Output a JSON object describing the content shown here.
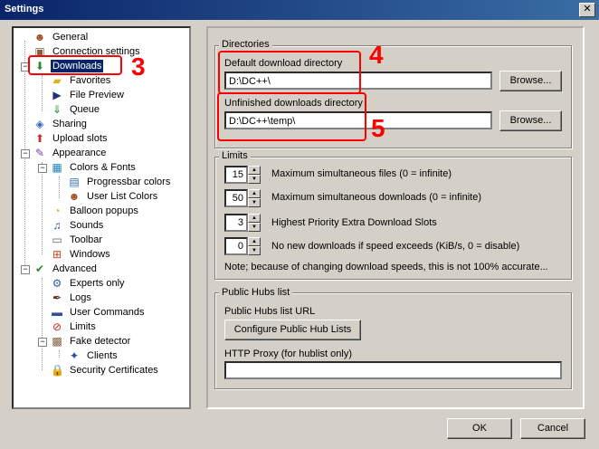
{
  "window": {
    "title": "Settings",
    "close_label": "✕"
  },
  "tree": {
    "items": [
      {
        "label": "General",
        "icon": "user-icon"
      },
      {
        "label": "Connection settings",
        "icon": "network-icon"
      },
      {
        "label": "Downloads",
        "icon": "download-icon"
      },
      {
        "label": "Favorites",
        "icon": "folder-icon"
      },
      {
        "label": "File Preview",
        "icon": "play-icon"
      },
      {
        "label": "Queue",
        "icon": "queue-icon"
      },
      {
        "label": "Sharing",
        "icon": "share-icon"
      },
      {
        "label": "Upload slots",
        "icon": "upload-icon"
      },
      {
        "label": "Appearance",
        "icon": "palette-icon"
      },
      {
        "label": "Colors & Fonts",
        "icon": "colors-icon"
      },
      {
        "label": "Progressbar colors",
        "icon": "progressbar-icon"
      },
      {
        "label": "User List Colors",
        "icon": "userlist-icon"
      },
      {
        "label": "Balloon popups",
        "icon": "balloon-icon"
      },
      {
        "label": "Sounds",
        "icon": "note-icon"
      },
      {
        "label": "Toolbar",
        "icon": "toolbar-icon"
      },
      {
        "label": "Windows",
        "icon": "windows-icon"
      },
      {
        "label": "Advanced",
        "icon": "check-icon"
      },
      {
        "label": "Experts only",
        "icon": "gear-icon"
      },
      {
        "label": "Logs",
        "icon": "log-icon"
      },
      {
        "label": "User Commands",
        "icon": "command-icon"
      },
      {
        "label": "Limits",
        "icon": "limit-icon"
      },
      {
        "label": "Fake detector",
        "icon": "detector-icon"
      },
      {
        "label": "Clients",
        "icon": "client-icon"
      },
      {
        "label": "Security Certificates",
        "icon": "lock-icon"
      }
    ]
  },
  "directories": {
    "legend": "Directories",
    "default_label": "Default download directory",
    "default_value": "D:\\DC++\\",
    "unfinished_label": "Unfinished downloads directory",
    "unfinished_value": "D:\\DC++\\temp\\",
    "browse_label": "Browse..."
  },
  "limits": {
    "legend": "Limits",
    "rows": [
      {
        "value": "15",
        "label": "Maximum simultaneous files (0 = infinite)"
      },
      {
        "value": "50",
        "label": "Maximum simultaneous downloads (0 = infinite)"
      },
      {
        "value": "3",
        "label": "Highest Priority Extra Download Slots"
      },
      {
        "value": "0",
        "label": "No new downloads if speed exceeds (KiB/s, 0 = disable)"
      }
    ],
    "note": "Note; because of changing download speeds, this is not 100% accurate..."
  },
  "hubs": {
    "legend": "Public Hubs list",
    "url_label": "Public Hubs list URL",
    "configure_label": "Configure Public Hub Lists",
    "proxy_label": "HTTP Proxy (for hublist only)",
    "proxy_value": ""
  },
  "footer": {
    "ok_label": "OK",
    "cancel_label": "Cancel"
  },
  "annotations": [
    {
      "number": "3"
    },
    {
      "number": "4"
    },
    {
      "number": "5"
    }
  ],
  "colors": {
    "annotation": "#ff0000",
    "selection": "#0a246a"
  }
}
